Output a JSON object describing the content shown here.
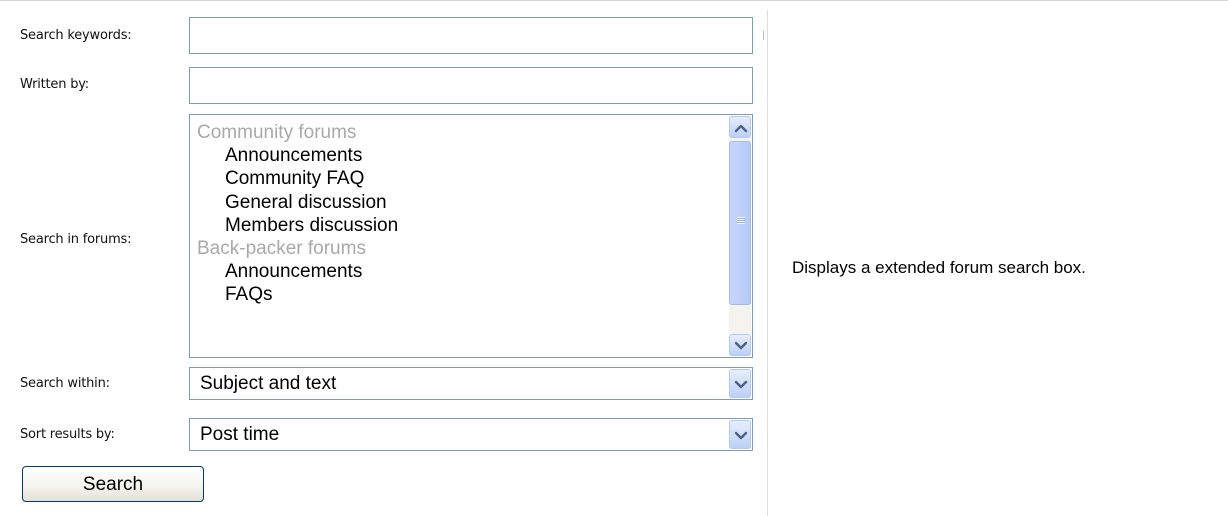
{
  "form": {
    "keywords_label": "Search keywords:",
    "keywords_value": "",
    "author_label": "Written by:",
    "author_value": "",
    "forums_label": "Search in forums:",
    "forums": [
      {
        "label": "Community forums",
        "type": "group"
      },
      {
        "label": "Announcements",
        "type": "forum"
      },
      {
        "label": "Community FAQ",
        "type": "forum"
      },
      {
        "label": "General discussion",
        "type": "forum"
      },
      {
        "label": "Members discussion",
        "type": "forum"
      },
      {
        "label": "Back-packer forums",
        "type": "group"
      },
      {
        "label": "Announcements",
        "type": "forum"
      },
      {
        "label": "FAQs",
        "type": "forum"
      }
    ],
    "within_label": "Search within:",
    "within_value": "Subject and text",
    "sort_label": "Sort results by:",
    "sort_value": "Post time",
    "search_button": "Search"
  },
  "description": "Displays a extended forum search box.",
  "icons": {
    "scroll_up": "chevron-up-icon",
    "scroll_down": "chevron-down-icon",
    "dropdown": "chevron-down-icon"
  },
  "colors": {
    "group_text": "#a9a9a9",
    "input_border": "#7f9db9",
    "scrollbar_blue": "#c1d3fb"
  }
}
